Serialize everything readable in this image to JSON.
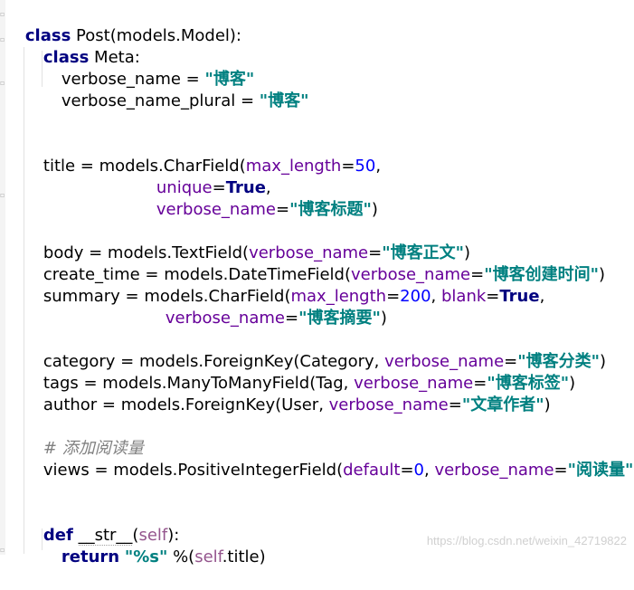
{
  "code": {
    "l1": {
      "kw": "class",
      "rest": " Post(models.Model):"
    },
    "l2": {
      "kw": "class",
      "rest": " Meta:"
    },
    "l3": {
      "a": "verbose_name = ",
      "s": "\"博客\""
    },
    "l4": {
      "a": "verbose_name_plural = ",
      "s": "\"博客\""
    },
    "l5": {
      "a": "title = models.CharField(",
      "k": "max_length",
      "eq": "=",
      "n": "50",
      "c": ","
    },
    "l6": {
      "k": "unique",
      "eq": "=",
      "b": "True",
      "c": ","
    },
    "l7": {
      "k": "verbose_name",
      "eq": "=",
      "s": "\"博客标题\"",
      "c": ")"
    },
    "l8": {
      "a": "body = models.TextField(",
      "k": "verbose_name",
      "eq": "=",
      "s": "\"博客正文\"",
      "c": ")"
    },
    "l9": {
      "a": "create_time = models.DateTimeField(",
      "k": "verbose_name",
      "eq": "=",
      "s": "\"博客创建时间\"",
      "c": ")"
    },
    "l10": {
      "a": "summary = models.CharField(",
      "k": "max_length",
      "eq": "=",
      "n": "200",
      "c1": ", ",
      "k2": "blank",
      "eq2": "=",
      "b": "True",
      "c": ","
    },
    "l11": {
      "k": "verbose_name",
      "eq": "=",
      "s": "\"博客摘要\"",
      "c": ")"
    },
    "l12": {
      "a": "category = models.ForeignKey(Category, ",
      "k": "verbose_name",
      "eq": "=",
      "s": "\"博客分类\"",
      "c": ")"
    },
    "l13": {
      "a": "tags = models.ManyToManyField(Tag, ",
      "k": "verbose_name",
      "eq": "=",
      "s": "\"博客标签\"",
      "c": ")"
    },
    "l14": {
      "a": "author = models.ForeignKey(User, ",
      "k": "verbose_name",
      "eq": "=",
      "s": "\"文章作者\"",
      "c": ")"
    },
    "l15": {
      "cmt": "# 添加阅读量"
    },
    "l16": {
      "a": "views = models.PositiveIntegerField(",
      "k": "default",
      "eq": "=",
      "n": "0",
      "c1": ", ",
      "k2": "verbose_name",
      "eq2": "=",
      "s": "\"阅读量\"",
      "c": ")"
    },
    "l17": {
      "kw": "def",
      "sp": " ",
      "name": "__str__",
      "p1": "(",
      "self": "self",
      "p2": "):"
    },
    "l18": {
      "kw": "return",
      "sp": " ",
      "s": "\"%s\"",
      "a": " %(",
      "self": "self",
      "b": ".title)"
    }
  },
  "watermark": "https://blog.csdn.net/weixin_42719822",
  "colors": {
    "keyword": "#000080",
    "string": "#008080",
    "number": "#0000ff",
    "kwarg": "#660099",
    "self": "#94558d",
    "comment": "#808080"
  }
}
